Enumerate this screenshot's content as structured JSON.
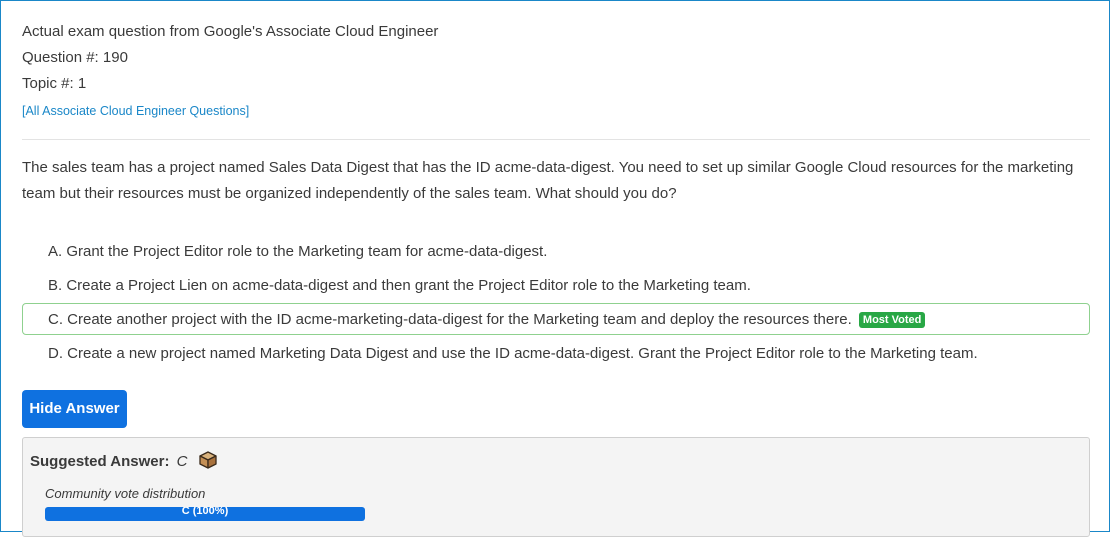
{
  "header": {
    "title": "Actual exam question from Google's Associate Cloud Engineer",
    "question_number": "Question #: 190",
    "topic": "Topic #: 1",
    "all_questions_link": "[All Associate Cloud Engineer Questions]"
  },
  "question": {
    "text": "The sales team has a project named Sales Data Digest that has the ID acme-data-digest. You need to set up similar Google Cloud resources for the marketing team but their resources must be organized independently of the sales team. What should you do?"
  },
  "choices": [
    {
      "text": "A. Grant the Project Editor role to the Marketing team for acme-data-digest."
    },
    {
      "text": "B. Create a Project Lien on acme-data-digest and then grant the Project Editor role to the Marketing team."
    },
    {
      "text": "C. Create another project with the ID acme-marketing-data-digest for the Marketing team and deploy the resources there.",
      "badge": "Most Voted"
    },
    {
      "text": "D. Create a new project named Marketing Data Digest and use the ID acme-data-digest. Grant the Project Editor role to the Marketing team."
    }
  ],
  "hide_answer_label": "Hide Answer",
  "answer": {
    "suggested_label": "Suggested Answer:",
    "suggested_value": "C",
    "icon": "box-icon",
    "community_label": "Community vote distribution",
    "vote_label": "C (100%)",
    "vote_fraction": 1.0
  },
  "colors": {
    "accent": "#0f71e0",
    "link": "#1a87c8",
    "badge": "#28a745",
    "voted_border": "#8fd18f"
  }
}
